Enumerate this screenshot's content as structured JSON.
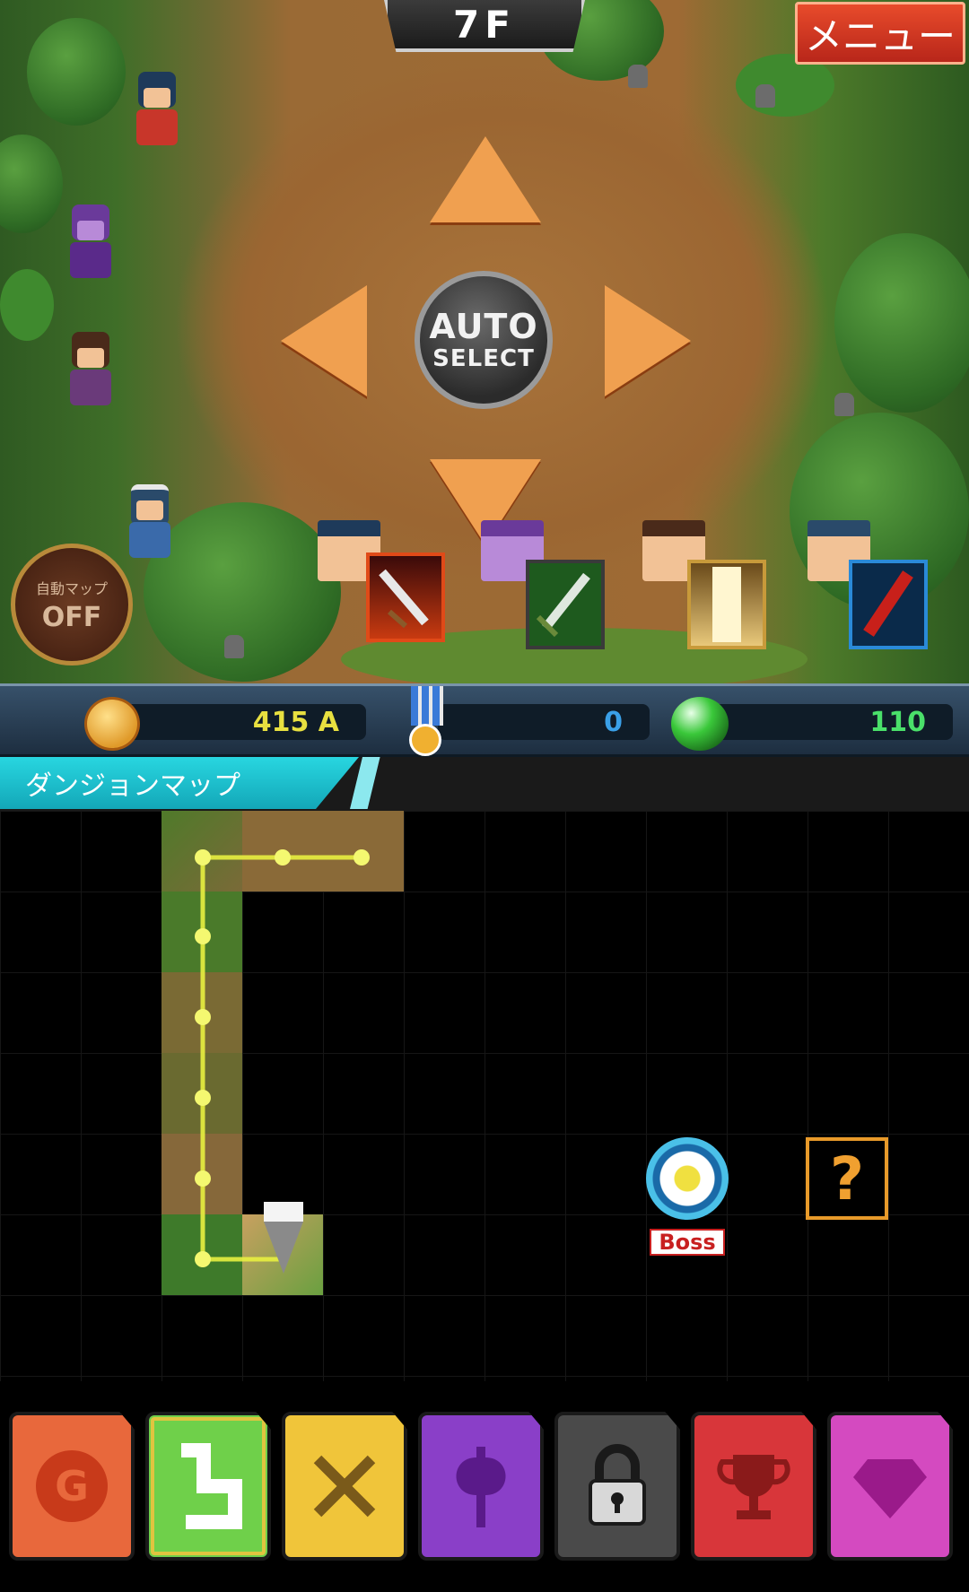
{
  "game": {
    "floor_label": "7F",
    "menu_label": "メニュー",
    "auto_select": {
      "line1": "AUTO",
      "line2": "SELECT"
    },
    "auto_map": {
      "label": "自動マップ",
      "state": "OFF"
    }
  },
  "resources": {
    "gold": {
      "icon": "gold-coin-icon",
      "value": "415 A"
    },
    "medal": {
      "icon": "medal-icon",
      "value": "0"
    },
    "gem": {
      "icon": "green-gem-icon",
      "value": "110"
    }
  },
  "map": {
    "title": "ダンジョンマップ",
    "boss_label": "Boss",
    "unknown_label": "?"
  },
  "bottom_nav": [
    {
      "id": "gold",
      "icon": "g-coin-icon",
      "glyph": "G",
      "color": "#e86a3e"
    },
    {
      "id": "map",
      "icon": "map-route-icon",
      "glyph": "",
      "color": "#6fd04a",
      "selected": true
    },
    {
      "id": "battle",
      "icon": "crossed-swords-icon",
      "glyph": "",
      "color": "#f0c53a"
    },
    {
      "id": "equipment",
      "icon": "battle-axe-icon",
      "glyph": "",
      "color": "#8a3fc8"
    },
    {
      "id": "locked",
      "icon": "padlock-icon",
      "glyph": "",
      "color": "#4a4a4a"
    },
    {
      "id": "ranking",
      "icon": "trophy-icon",
      "glyph": "",
      "color": "#d8363a"
    },
    {
      "id": "shop",
      "icon": "gem-icon",
      "glyph": "",
      "color": "#d44ac0"
    }
  ],
  "colors": {
    "accent_cyan": "#13a7b8",
    "path_glow": "#e8f040",
    "menu_red": "#c8301f"
  }
}
